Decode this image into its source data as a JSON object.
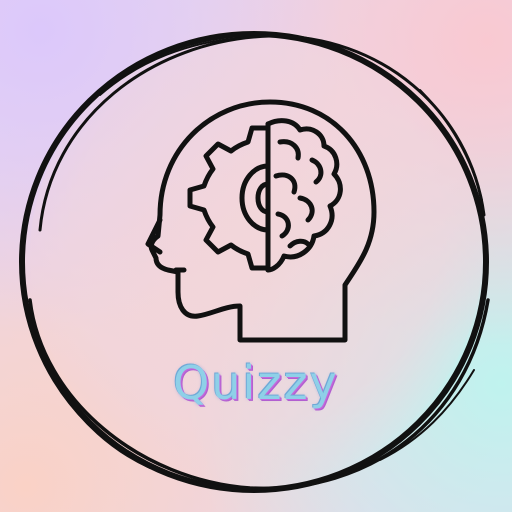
{
  "logo": {
    "brand_name": "Quizzy",
    "icon": "head-gear-brain-icon",
    "frame": "brush-circle-icon"
  },
  "colors": {
    "ink": "#111111",
    "text_fill": "#8fd0e8",
    "text_shadow": "#c46adb",
    "bg_lavender": "#dcc8fb",
    "bg_pink": "#f9c9d1",
    "bg_mint": "#bff3ee",
    "bg_peach": "#fad2c6"
  }
}
